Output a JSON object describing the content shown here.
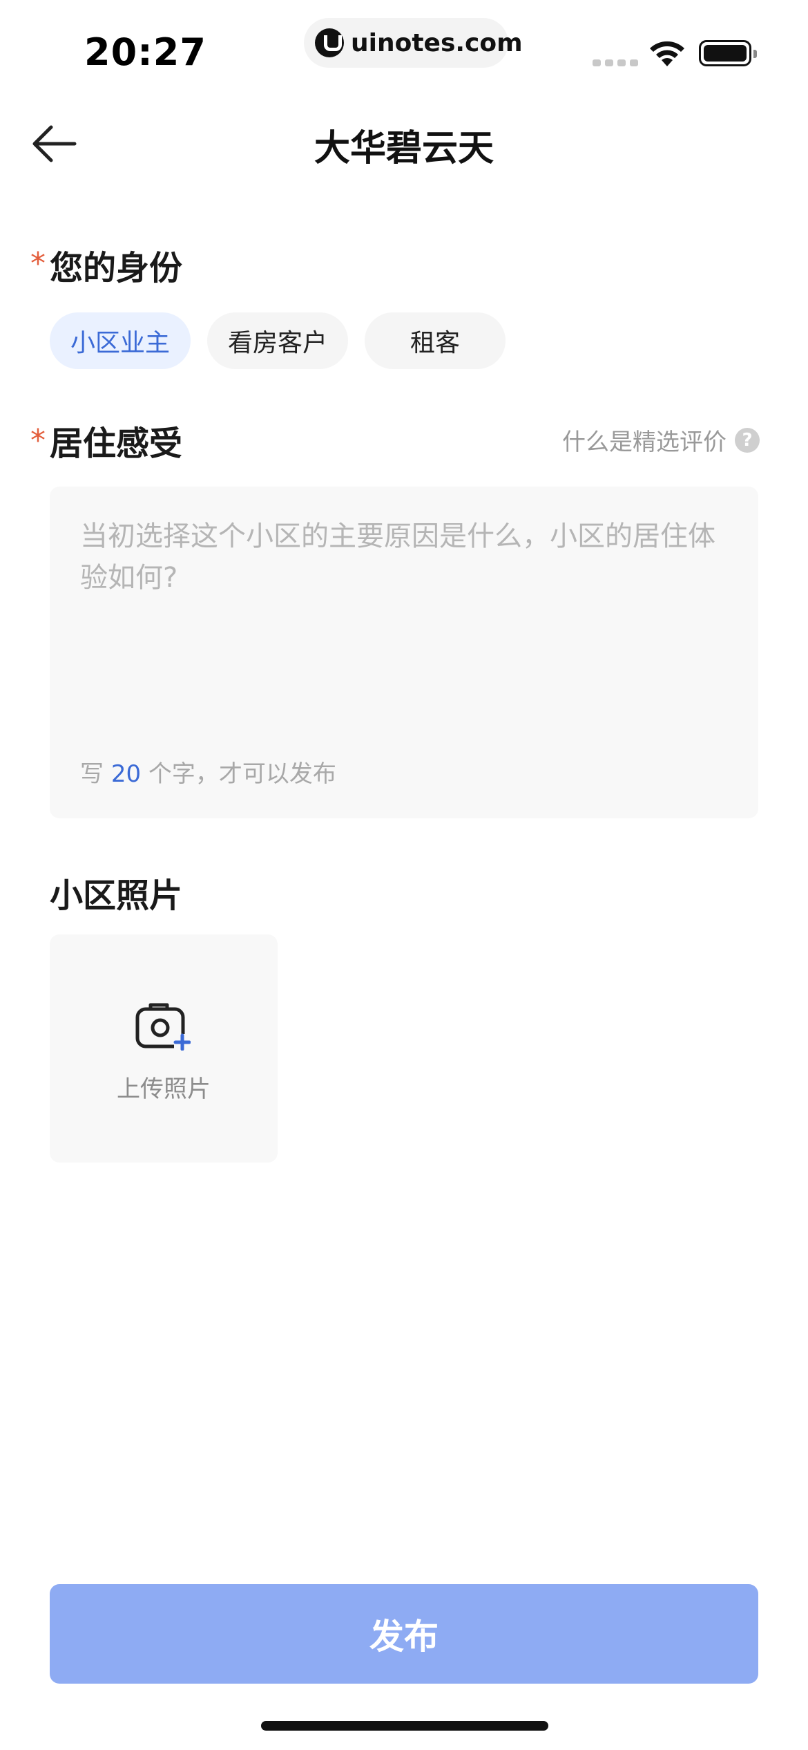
{
  "status_bar": {
    "time": "20:27",
    "url": "uinotes.com"
  },
  "nav": {
    "title": "大华碧云天"
  },
  "identity": {
    "title": "您的身份",
    "required_mark": "*",
    "options": [
      "小区业主",
      "看房客户",
      "租客"
    ],
    "selected": "小区业主"
  },
  "review": {
    "title": "居住感受",
    "required_mark": "*",
    "help_label": "什么是精选评价",
    "help_icon_glyph": "?",
    "placeholder": "当初选择这个小区的主要原因是什么，小区的居住体验如何?",
    "value": "",
    "hint_prefix": "写 ",
    "hint_count": "20",
    "hint_suffix": " 个字，才可以发布"
  },
  "photos": {
    "title": "小区照片",
    "upload_label": "上传照片"
  },
  "publish": {
    "label": "发布"
  },
  "colors": {
    "accent": "#3b6ad6",
    "required": "#e35d3b",
    "button_disabled": "#8eabf3",
    "chip_active_bg": "#eaf1ff"
  },
  "icons": {
    "back": "arrow-left-icon",
    "camera": "camera-plus-icon",
    "help": "question-circle-icon"
  }
}
